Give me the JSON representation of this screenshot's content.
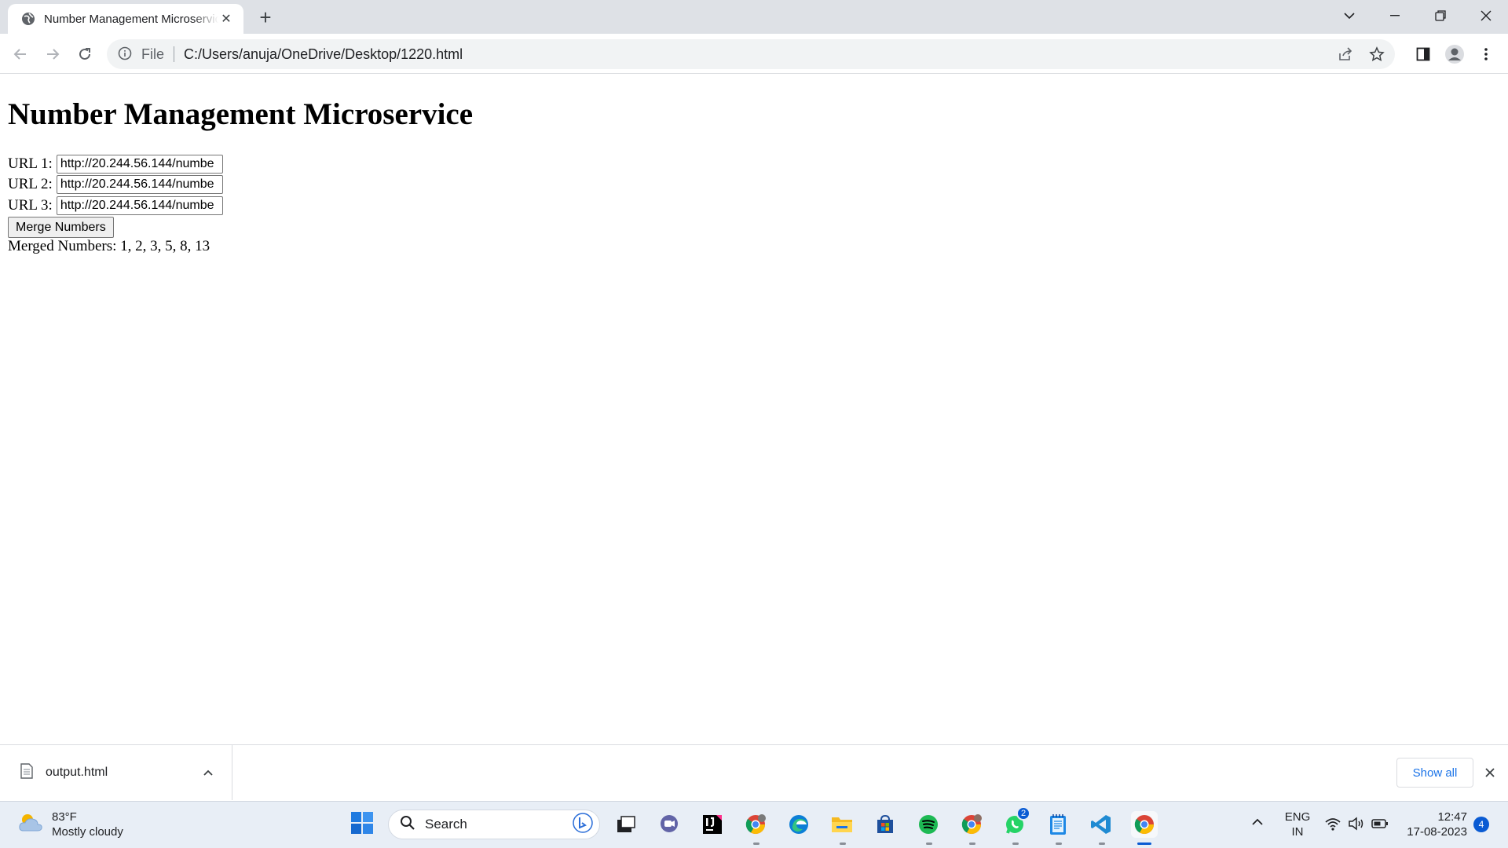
{
  "browser": {
    "tab_title": "Number Management Microservice",
    "address_scheme": "File",
    "address_url": "C:/Users/anuja/OneDrive/Desktop/1220.html"
  },
  "page": {
    "heading": "Number Management Microservice",
    "url_rows": [
      {
        "label": "URL 1:",
        "value": "http://20.244.56.144/numbe"
      },
      {
        "label": "URL 2:",
        "value": "http://20.244.56.144/numbe"
      },
      {
        "label": "URL 3:",
        "value": "http://20.244.56.144/numbe"
      }
    ],
    "merge_button": "Merge Numbers",
    "merged_result": "Merged Numbers: 1, 2, 3, 5, 8, 13"
  },
  "downloads": {
    "file_name": "output.html",
    "show_all": "Show all"
  },
  "taskbar": {
    "weather_temp": "83°F",
    "weather_desc": "Mostly cloudy",
    "search_label": "Search",
    "lang_top": "ENG",
    "lang_bottom": "IN",
    "time": "12:47",
    "date": "17-08-2023",
    "notification_count": "4",
    "whatsapp_badge": "2",
    "apps": [
      "chrome-profile",
      "edge",
      "file-explorer",
      "microsoft-store",
      "spotify",
      "chrome-profile-2",
      "whatsapp",
      "notepad",
      "vscode",
      "chrome"
    ]
  },
  "colors": {
    "accent_blue": "#1a73e8",
    "tabstrip": "#dee1e6",
    "taskbar": "#e8eef6"
  }
}
